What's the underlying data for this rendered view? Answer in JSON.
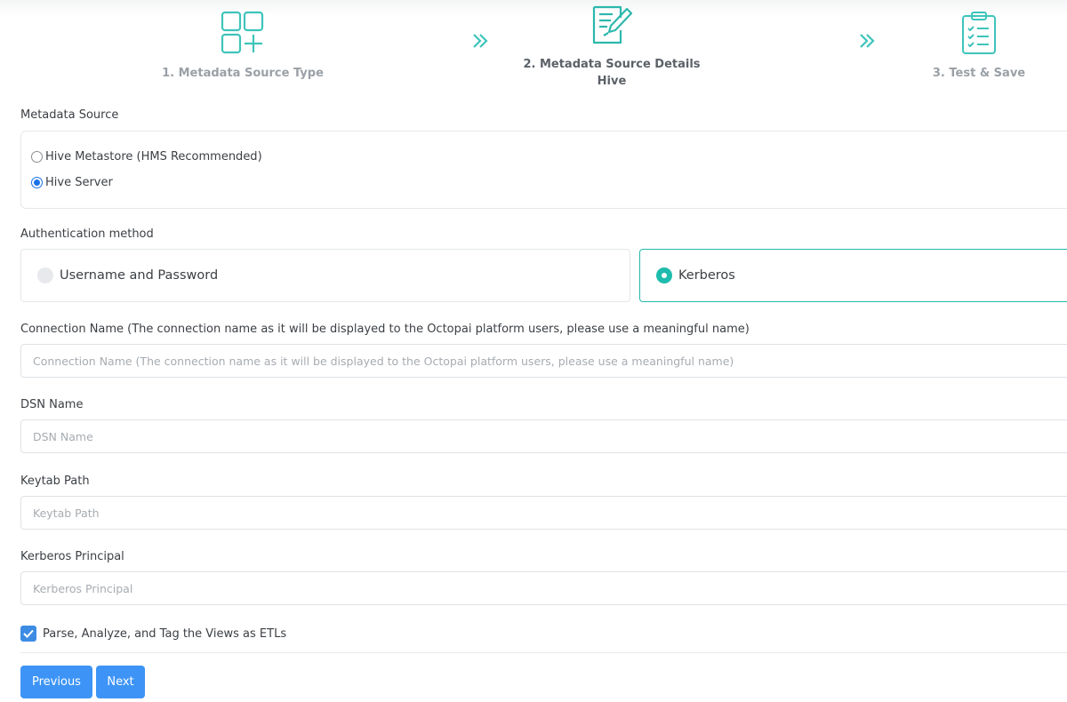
{
  "stepper": {
    "steps": [
      {
        "label": "1. Metadata Source Type",
        "icon": "grid-plus-icon"
      },
      {
        "label": "2. Metadata Source Details",
        "sublabel": "Hive",
        "icon": "edit-document-icon"
      },
      {
        "label": "3. Test & Save",
        "icon": "clipboard-checklist-icon"
      }
    ],
    "separator_icon": "double-chevron-right-icon"
  },
  "metadata_source": {
    "label": "Metadata Source",
    "options": [
      {
        "label": "Hive Metastore (HMS Recommended)",
        "checked": false
      },
      {
        "label": "Hive Server",
        "checked": true
      }
    ]
  },
  "auth": {
    "label": "Authentication method",
    "options": [
      {
        "label": "Username and Password",
        "selected": false
      },
      {
        "label": "Kerberos",
        "selected": true
      }
    ]
  },
  "fields": {
    "connection_name": {
      "label": "Connection Name (The connection name as it will be displayed to the Octopai platform users, please use a meaningful name)",
      "placeholder": "Connection Name (The connection name as it will be displayed to the Octopai platform users, please use a meaningful name)",
      "value": ""
    },
    "dsn_name": {
      "label": "DSN Name",
      "placeholder": "DSN Name",
      "value": ""
    },
    "keytab_path": {
      "label": "Keytab Path",
      "placeholder": "Keytab Path",
      "value": ""
    },
    "kerberos_principal": {
      "label": "Kerberos Principal",
      "placeholder": "Kerberos Principal",
      "value": ""
    }
  },
  "parse_views": {
    "label": "Parse, Analyze, and Tag the Views as ETLs",
    "checked": true
  },
  "buttons": {
    "previous": "Previous",
    "next": "Next"
  },
  "colors": {
    "accent_teal": "#21b9ad",
    "primary_blue": "#3d94f6",
    "radio_blue": "#1a73e8"
  }
}
